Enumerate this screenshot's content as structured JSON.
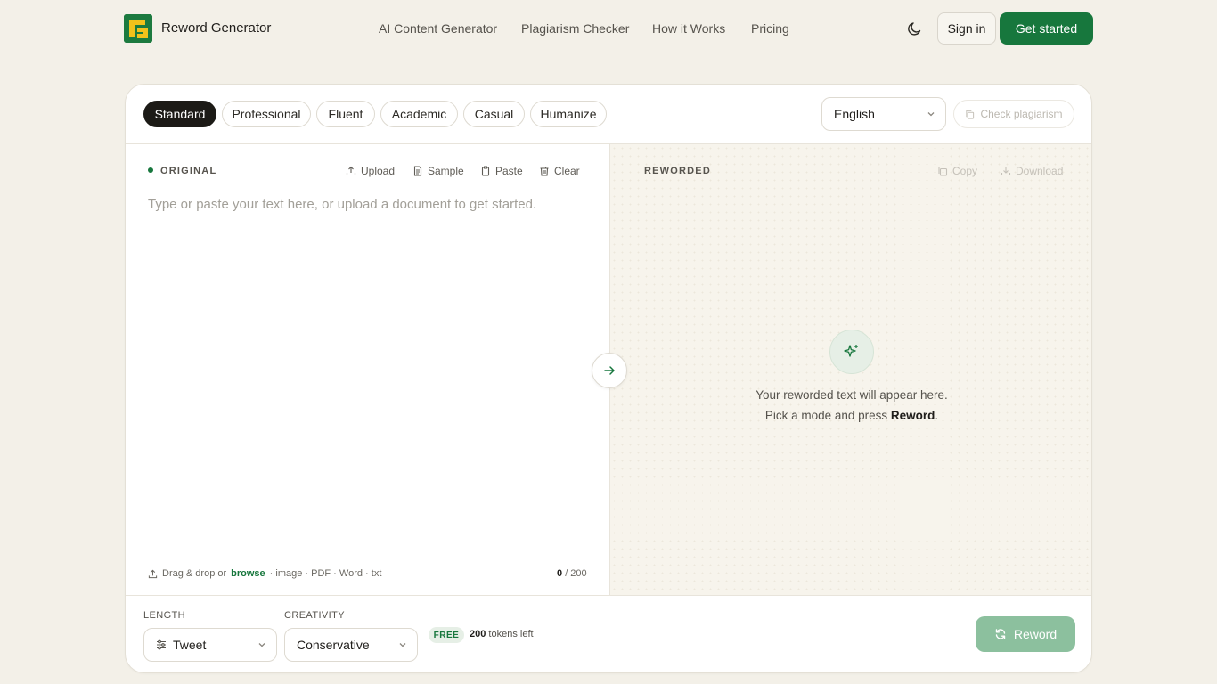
{
  "header": {
    "brand": "Reword Generator",
    "nav": [
      "AI Content Generator",
      "Plagiarism Checker",
      "How it Works",
      "Pricing"
    ],
    "sign_in": "Sign in",
    "get_started": "Get started"
  },
  "modes": {
    "items": [
      "Standard",
      "Professional",
      "Fluent",
      "Academic",
      "Casual",
      "Humanize"
    ],
    "selected": "Standard"
  },
  "language": {
    "selected": "English"
  },
  "check_plagiarism": "Check plagiarism",
  "original": {
    "label": "ORIGINAL",
    "tools": [
      "Upload",
      "Sample",
      "Paste",
      "Clear"
    ],
    "placeholder": "Type or paste your text here, or upload a document to get started.",
    "drag_prefix": "Drag & drop or",
    "drag_browse": "browse",
    "drag_suffix": "· image · PDF · Word · txt",
    "count": "0",
    "limit": "/ 200"
  },
  "reworded": {
    "label": "REWORDED",
    "tools": [
      "Copy",
      "Download"
    ],
    "empty_line1": "Your reworded text will appear here.",
    "empty_line2_prefix": "Pick a mode and press",
    "empty_line2_bold": "Reword",
    "empty_line2_suffix": "."
  },
  "footer": {
    "length_label": "LENGTH",
    "length_value": "Tweet",
    "creativity_label": "CREATIVITY",
    "creativity_value": "Conservative",
    "badge": "FREE",
    "tokens_count": "200",
    "tokens_text": "tokens left",
    "reword_button": "Reword"
  },
  "colors": {
    "accent": "#17773d",
    "background": "#f3f0e8",
    "active_pill": "#1c1a16",
    "reword_disabled": "#8cc09e"
  },
  "icons": [
    "logo-icon",
    "moon-icon",
    "chevron-down-icon",
    "copy-icon",
    "upload-icon",
    "document-icon",
    "clipboard-icon",
    "trash-icon",
    "download-icon",
    "arrow-right-icon",
    "sparkles-icon",
    "sliders-icon",
    "refresh-icon"
  ]
}
